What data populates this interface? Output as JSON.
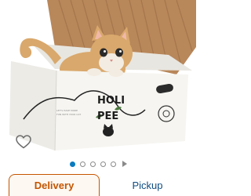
{
  "product_image": {
    "alt": "Cat in cardboard scratcher box",
    "brand_line1": "HOLI",
    "brand_line2": "PEE",
    "box_small_print": [
      "LET'S HAVE MORE",
      "FUN WITH YOUR CAT"
    ],
    "colors": {
      "box": "#f6f5f1",
      "box_shadow": "#e4e2dc",
      "cardboard": "#b8875a",
      "cat_fur": "#d9a86c",
      "cat_white": "#f3ece2"
    }
  },
  "favorite": {
    "icon": "heart-outline-icon"
  },
  "carousel": {
    "dot_count": 5,
    "active_index": 0,
    "play_icon": "play-icon",
    "active_color": "#0a7bbf"
  },
  "fulfillment_tabs": {
    "delivery_label": "Delivery",
    "pickup_label": "Pickup",
    "active": "delivery",
    "active_color": "#c45500",
    "link_color": "#0f4c81"
  }
}
